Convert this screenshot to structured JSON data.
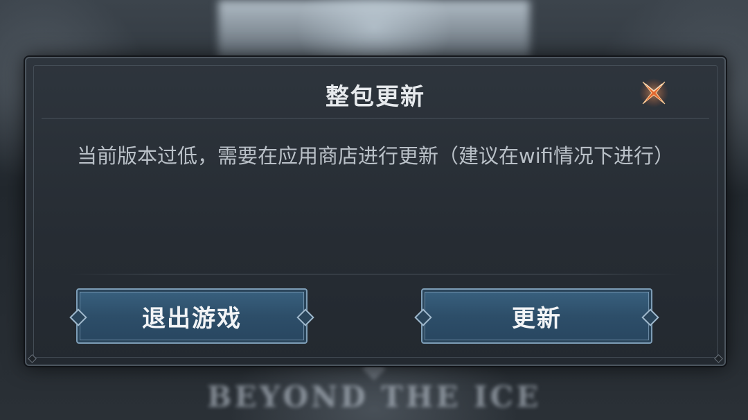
{
  "background": {
    "subtitle": "BEYOND THE ICE"
  },
  "dialog": {
    "title": "整包更新",
    "close_icon": "close-x-icon",
    "message": "当前版本过低，需要在应用商店进行更新（建议在wifi情况下进行）",
    "buttons": {
      "exit_label": "退出游戏",
      "update_label": "更新"
    }
  },
  "colors": {
    "button_fill": "#2d4e69",
    "close_accent": "#e8622a",
    "dialog_bg": "#2a3037"
  }
}
